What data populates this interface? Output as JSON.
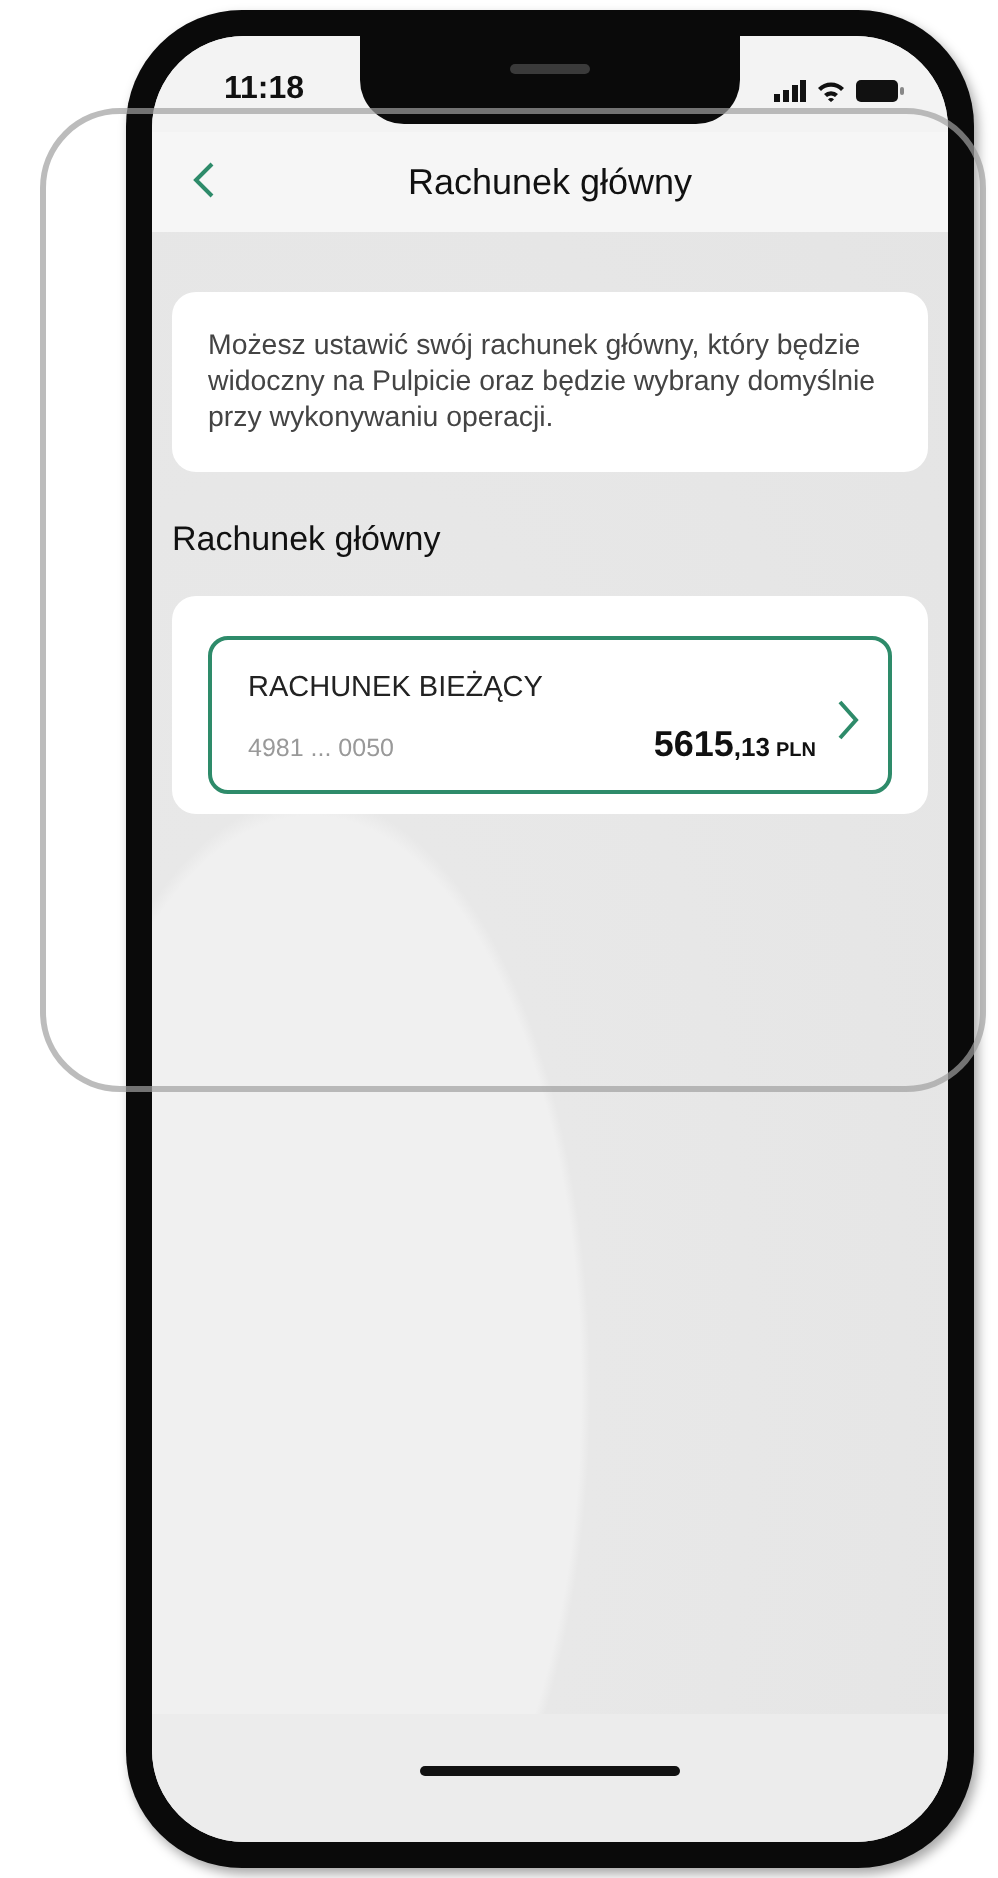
{
  "status_bar": {
    "time": "11:18"
  },
  "header": {
    "title": "Rachunek główny"
  },
  "info_card": {
    "text": "Możesz ustawić swój rachunek główny, który będzie widoczny na Pulpicie oraz będzie wybrany domyślnie przy wykonywaniu operacji."
  },
  "section": {
    "heading": "Rachunek główny"
  },
  "account": {
    "name": "RACHUNEK BIEŻĄCY",
    "number": "4981 ... 0050",
    "amount_integer": "5615",
    "amount_fraction": ",13",
    "currency": "PLN"
  }
}
